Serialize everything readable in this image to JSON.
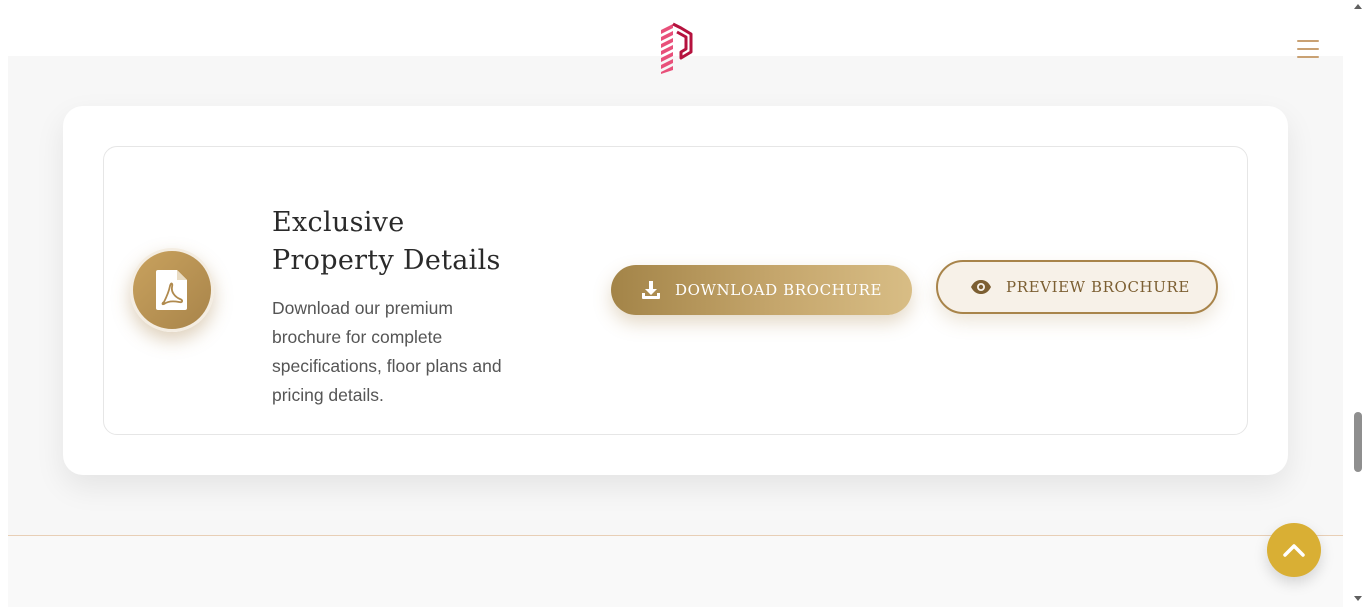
{
  "header": {
    "logo_icon": "building-logo-icon",
    "menu_icon": "hamburger-menu-icon",
    "menu_color": "#c9a173",
    "logo_color": "#c8194f"
  },
  "brochure": {
    "icon": "pdf-file-icon",
    "title_line1": "Exclusive",
    "title_line2": "Property Details",
    "description": "Download our premium brochure for complete specifications, floor plans and pricing details.",
    "download_button": {
      "label": "DOWNLOAD BROCHURE",
      "icon": "download-icon"
    },
    "preview_button": {
      "label": "PREVIEW BROCHURE",
      "icon": "eye-icon"
    },
    "accent_color": "#a8844a"
  },
  "scroll_to_top": {
    "icon": "chevron-up-icon",
    "color": "#d9af34"
  }
}
